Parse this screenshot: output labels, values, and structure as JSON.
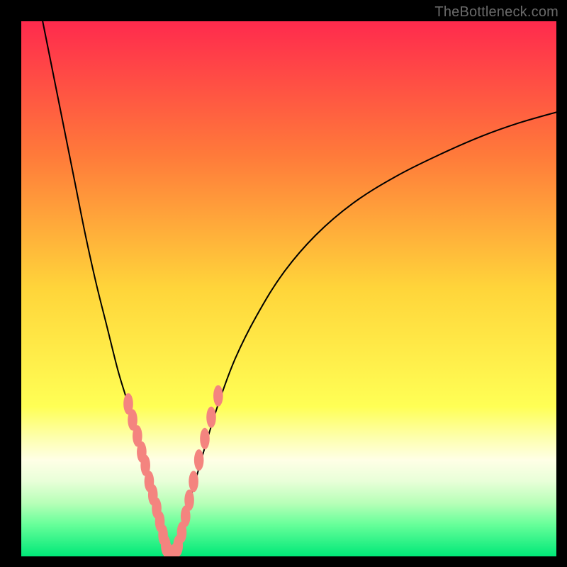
{
  "watermark": "TheBottleneck.com",
  "chart_data": {
    "type": "line",
    "title": "",
    "xlabel": "",
    "ylabel": "",
    "xlim": [
      0,
      100
    ],
    "ylim": [
      0,
      100
    ],
    "grid": false,
    "legend": false,
    "gradient_stops": [
      {
        "offset": 0.0,
        "color": "#ff2a4d"
      },
      {
        "offset": 0.25,
        "color": "#ff7a3a"
      },
      {
        "offset": 0.5,
        "color": "#ffd53a"
      },
      {
        "offset": 0.72,
        "color": "#ffff55"
      },
      {
        "offset": 0.78,
        "color": "#fdffb0"
      },
      {
        "offset": 0.82,
        "color": "#ffffe6"
      },
      {
        "offset": 0.86,
        "color": "#e8ffd8"
      },
      {
        "offset": 0.9,
        "color": "#b8ffb8"
      },
      {
        "offset": 0.94,
        "color": "#68ff9a"
      },
      {
        "offset": 1.0,
        "color": "#00e878"
      }
    ],
    "series": [
      {
        "name": "left-curve",
        "stroke": "#000000",
        "x": [
          4,
          6,
          8,
          10,
          12,
          14,
          16,
          18,
          19.5,
          21,
          22.5,
          24,
          25,
          26,
          26.8,
          27.4,
          27.8,
          28.0
        ],
        "y": [
          100,
          90,
          80,
          70,
          60,
          51,
          43,
          35,
          30,
          25,
          20,
          15,
          11,
          7,
          4,
          2,
          0.5,
          0
        ]
      },
      {
        "name": "right-curve",
        "stroke": "#000000",
        "x": [
          28.0,
          29,
          30,
          31,
          32.5,
          34.5,
          37,
          40,
          44,
          49,
          55,
          62,
          70,
          78,
          86,
          93,
          100
        ],
        "y": [
          0,
          2,
          5,
          9,
          14,
          21,
          29,
          37,
          45,
          53,
          60,
          66,
          71,
          75,
          78.5,
          81,
          83
        ]
      }
    ],
    "scatter": {
      "name": "highlight-points",
      "color": "#f4847f",
      "rx": 0.9,
      "ry": 2.0,
      "points": [
        {
          "x": 20.0,
          "y": 28.5
        },
        {
          "x": 20.8,
          "y": 25.5
        },
        {
          "x": 21.7,
          "y": 22.5
        },
        {
          "x": 22.5,
          "y": 19.5
        },
        {
          "x": 23.2,
          "y": 17.0
        },
        {
          "x": 23.9,
          "y": 14.0
        },
        {
          "x": 24.6,
          "y": 11.5
        },
        {
          "x": 25.3,
          "y": 9.0
        },
        {
          "x": 25.9,
          "y": 6.5
        },
        {
          "x": 26.5,
          "y": 4.0
        },
        {
          "x": 27.0,
          "y": 2.0
        },
        {
          "x": 27.5,
          "y": 0.6
        },
        {
          "x": 28.0,
          "y": 0.0
        },
        {
          "x": 28.7,
          "y": 0.5
        },
        {
          "x": 29.3,
          "y": 2.0
        },
        {
          "x": 30.0,
          "y": 4.5
        },
        {
          "x": 30.7,
          "y": 7.5
        },
        {
          "x": 31.4,
          "y": 10.5
        },
        {
          "x": 32.2,
          "y": 14.0
        },
        {
          "x": 33.2,
          "y": 18.0
        },
        {
          "x": 34.3,
          "y": 22.0
        },
        {
          "x": 35.5,
          "y": 26.0
        },
        {
          "x": 36.8,
          "y": 30.0
        }
      ]
    }
  }
}
